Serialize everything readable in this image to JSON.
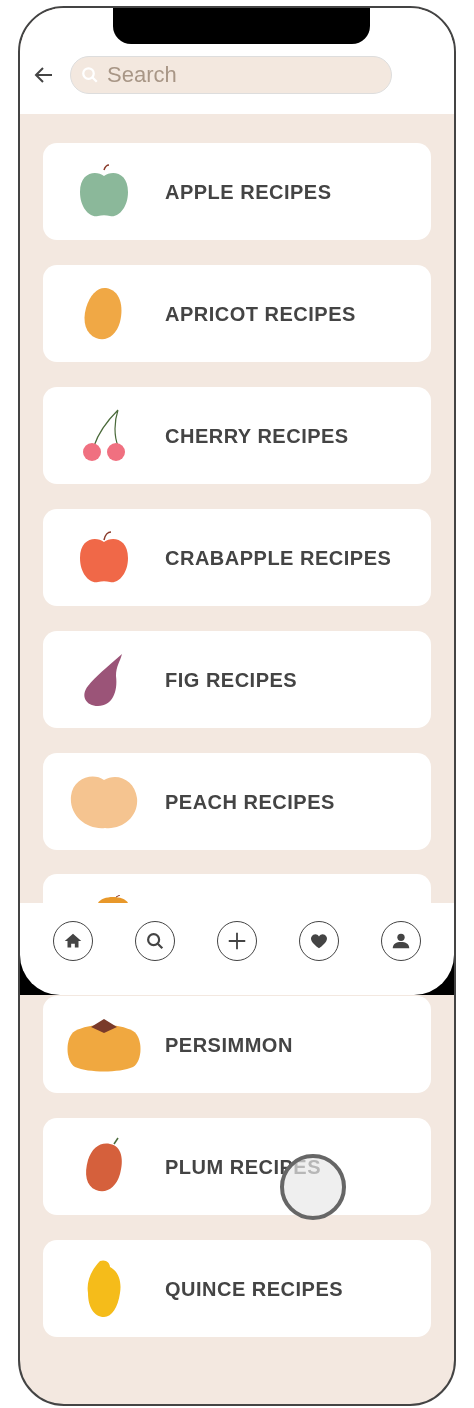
{
  "search": {
    "placeholder": "Search"
  },
  "recipes_above": [
    {
      "kind": "apple",
      "label": "APPLE RECIPES"
    },
    {
      "kind": "apricot",
      "label": "APRICOT RECIPES"
    },
    {
      "kind": "cherry",
      "label": "CHERRY RECIPES"
    },
    {
      "kind": "crabapple",
      "label": "CRABAPPLE RECIPES"
    },
    {
      "kind": "fig",
      "label": "FIG RECIPES"
    },
    {
      "kind": "peach",
      "label": "PEACH RECIPES"
    }
  ],
  "partially_hidden": {
    "kind": "orange"
  },
  "nav": [
    {
      "kind": "home"
    },
    {
      "kind": "search"
    },
    {
      "kind": "add"
    },
    {
      "kind": "heart"
    },
    {
      "kind": "profile"
    }
  ],
  "recipes_below": [
    {
      "kind": "persimmon",
      "label": "PERSIMMON"
    },
    {
      "kind": "plum",
      "label": "PLUM RECIPES"
    },
    {
      "kind": "quince",
      "label": "QUINCE RECIPES"
    }
  ]
}
